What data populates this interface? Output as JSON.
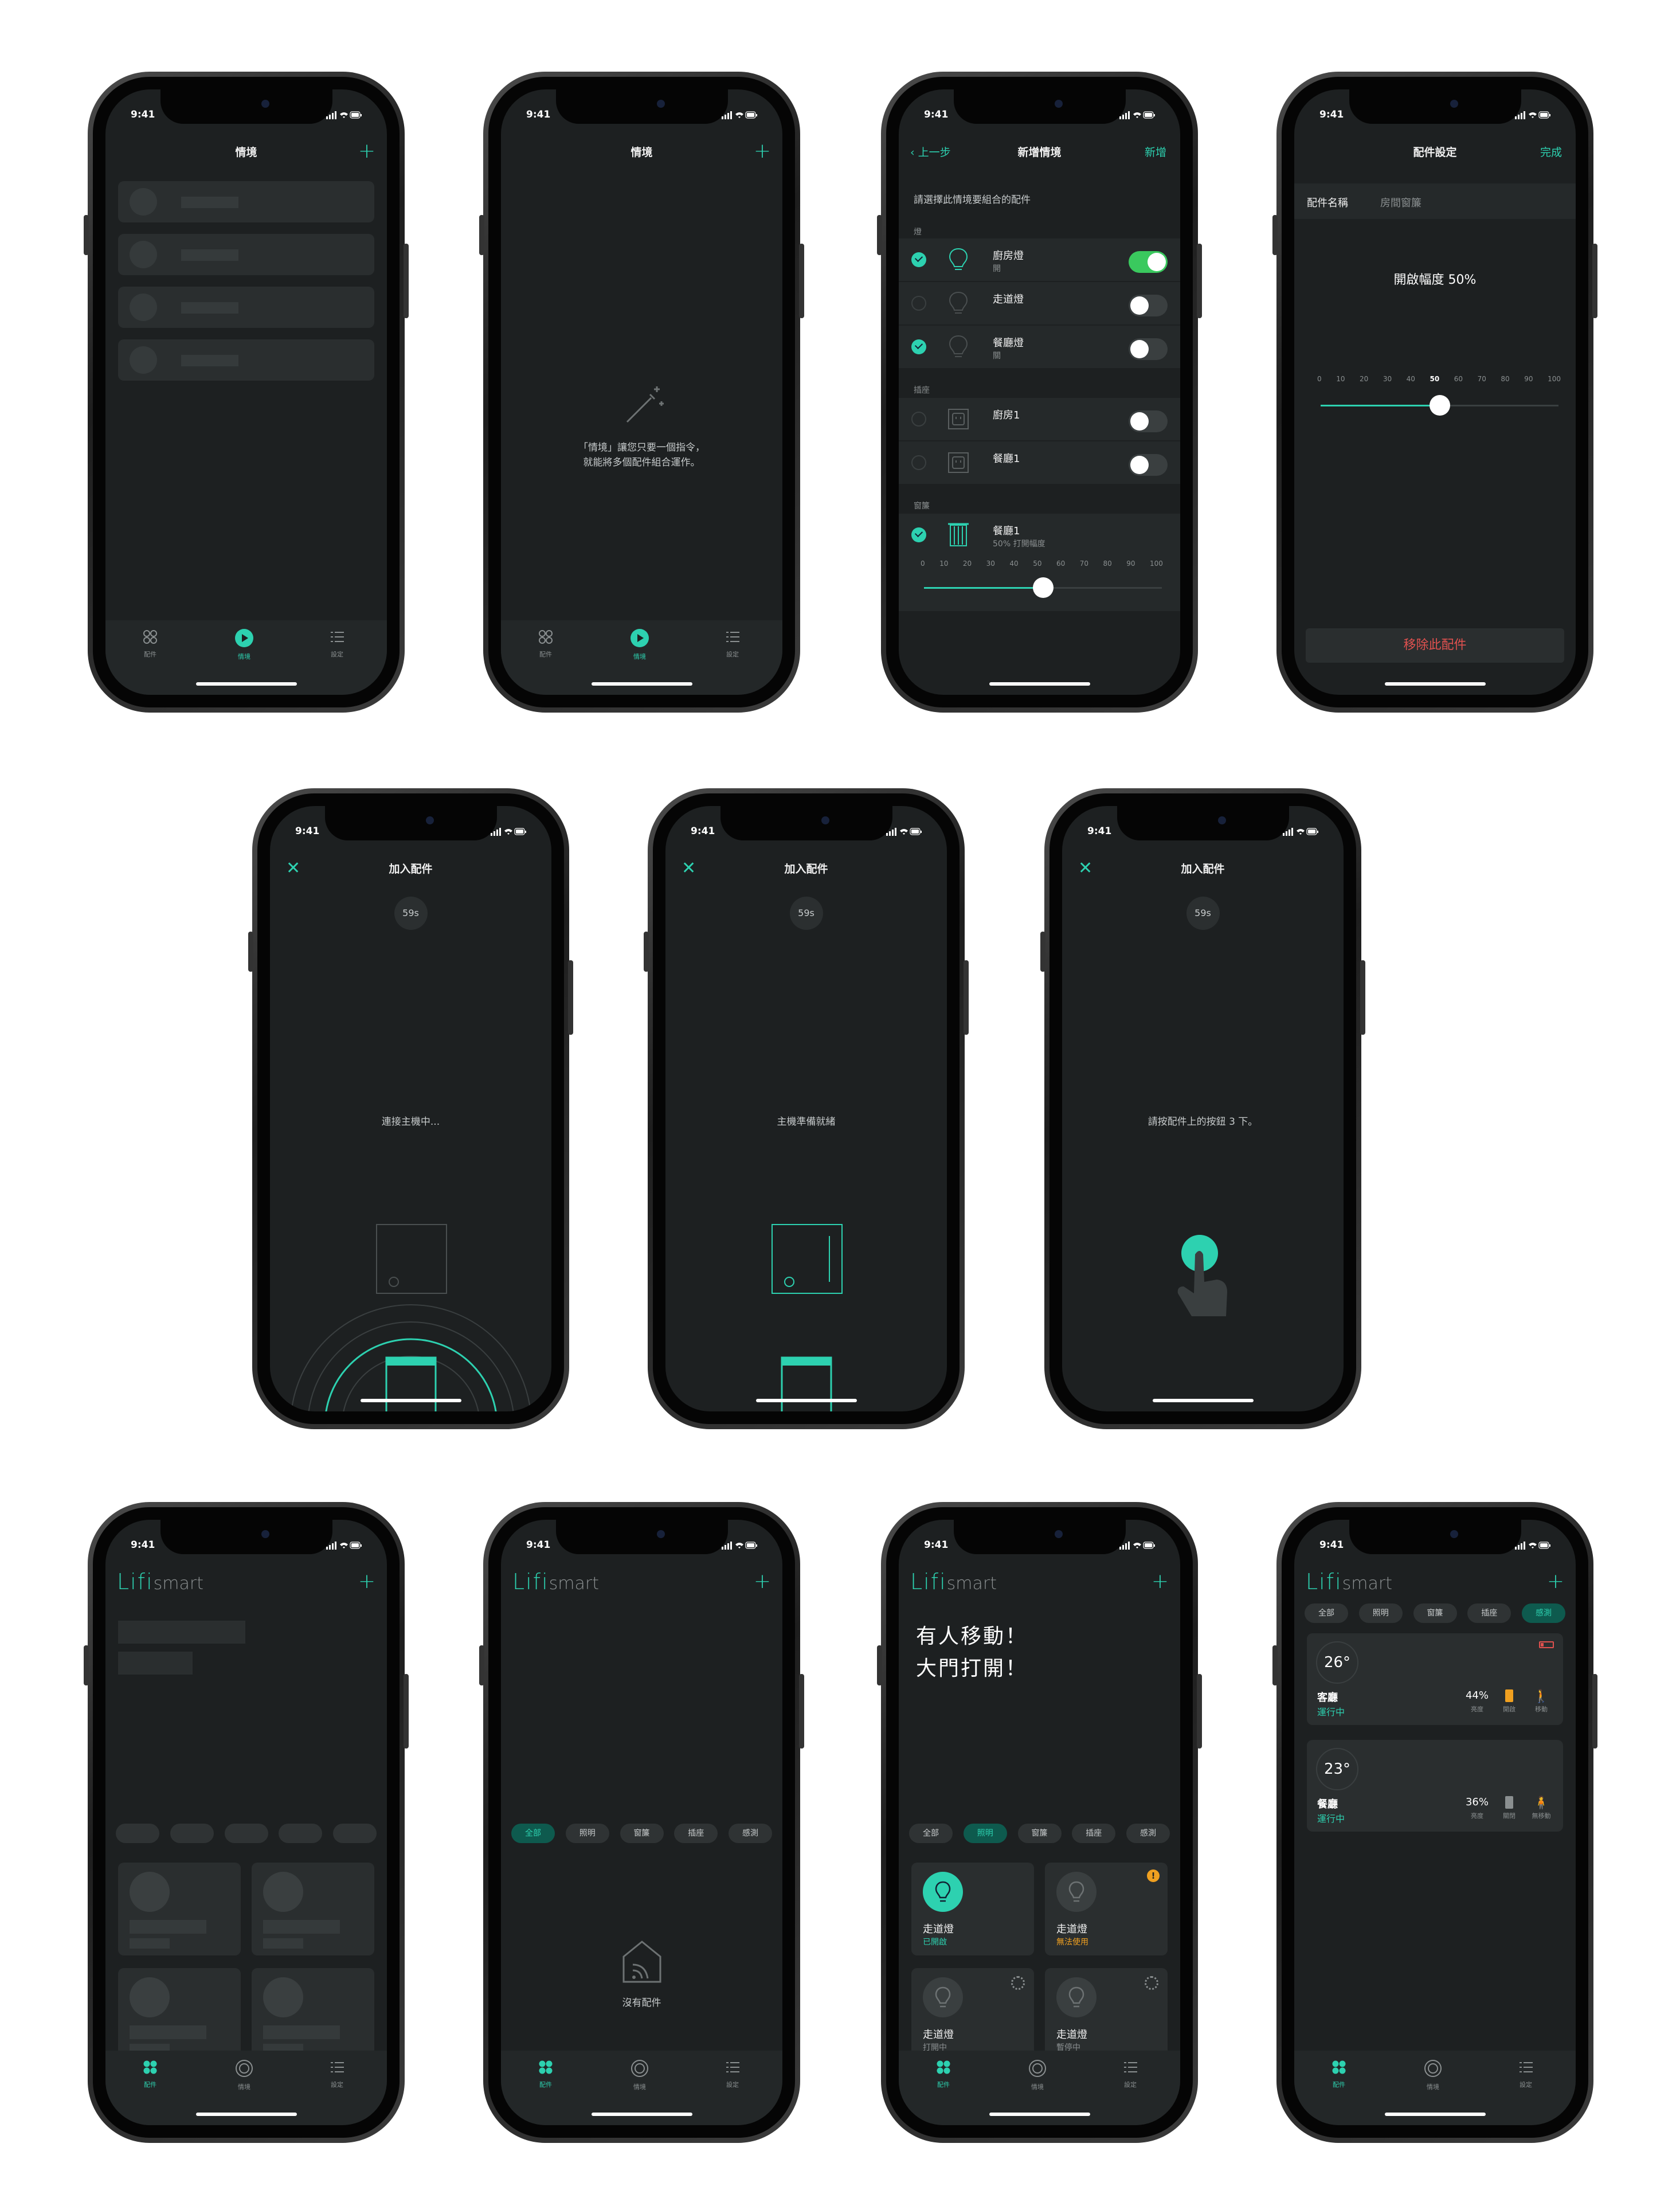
{
  "status_time": "9:41",
  "tabs": {
    "accessories": "配件",
    "scenes": "情境",
    "settings": "設定"
  },
  "s1": {
    "title": "情境"
  },
  "s2": {
    "title": "情境",
    "empty_line1": "「情境」讓您只要一個指令，",
    "empty_line2": "就能將多個配件組合運作。"
  },
  "s3": {
    "back": "上一步",
    "title": "新增情境",
    "action": "新增",
    "hint": "請選擇此情境要組合的配件",
    "group_light": "燈",
    "group_socket": "插座",
    "group_curtain": "窗簾",
    "lights": [
      {
        "name": "廚房燈",
        "sub": "開",
        "checked": true,
        "on": true
      },
      {
        "name": "走道燈",
        "sub": "",
        "checked": false,
        "on": false
      },
      {
        "name": "餐廳燈",
        "sub": "關",
        "checked": true,
        "on": false
      }
    ],
    "sockets": [
      {
        "name": "廚房1",
        "checked": false,
        "on": false
      },
      {
        "name": "餐廳1",
        "checked": false,
        "on": false
      }
    ],
    "curtain": {
      "name": "餐廳1",
      "sub": "50% 打開幅度",
      "checked": true,
      "value": 50
    },
    "scale": [
      "0",
      "10",
      "20",
      "30",
      "40",
      "50",
      "60",
      "70",
      "80",
      "90",
      "100"
    ]
  },
  "s4": {
    "title": "配件設定",
    "action": "完成",
    "name_label": "配件名稱",
    "name_value": "房間窗簾",
    "open_label": "開啟幅度 50%",
    "value": 50,
    "scale": [
      "0",
      "10",
      "20",
      "30",
      "40",
      "50",
      "60",
      "70",
      "80",
      "90",
      "100"
    ],
    "remove": "移除此配件",
    "remove_color": "#e0514f"
  },
  "s5": {
    "title": "加入配件",
    "timer": "59s",
    "msg": "連接主機中..."
  },
  "s6": {
    "title": "加入配件",
    "timer": "59s",
    "msg": "主機準備就緒"
  },
  "s7": {
    "title": "加入配件",
    "timer": "59s",
    "msg": "請按配件上的按鈕 3 下。"
  },
  "logo": {
    "mark": "Lifi",
    "word": "smart"
  },
  "chips": [
    "全部",
    "照明",
    "窗簾",
    "插座",
    "感測"
  ],
  "s9": {
    "empty": "沒有配件"
  },
  "s10": {
    "msg_line1": "有人移動！",
    "msg_line2": "大門打開！",
    "cards": [
      {
        "name": "走道燈",
        "status": "已開啟",
        "status_color": "#2dd1b0"
      },
      {
        "name": "走道燈",
        "status": "無法使用",
        "status_color": "#f0a020"
      },
      {
        "name": "走道燈",
        "status": "打開中",
        "status_color": "#8a8f90"
      },
      {
        "name": "走道燈",
        "status": "暫停中",
        "status_color": "#8a8f90"
      }
    ]
  },
  "s11": {
    "sensors": [
      {
        "temp": "26°",
        "room": "客廳",
        "state": "運行中",
        "brightness": "44%",
        "m1": "亮度",
        "m2": "開啟",
        "m3": "移動"
      },
      {
        "temp": "23°",
        "room": "餐廳",
        "state": "運行中",
        "brightness": "36%",
        "m1": "亮度",
        "m2": "關閉",
        "m3": "無移動"
      }
    ]
  },
  "accent": "#2dd1b0"
}
